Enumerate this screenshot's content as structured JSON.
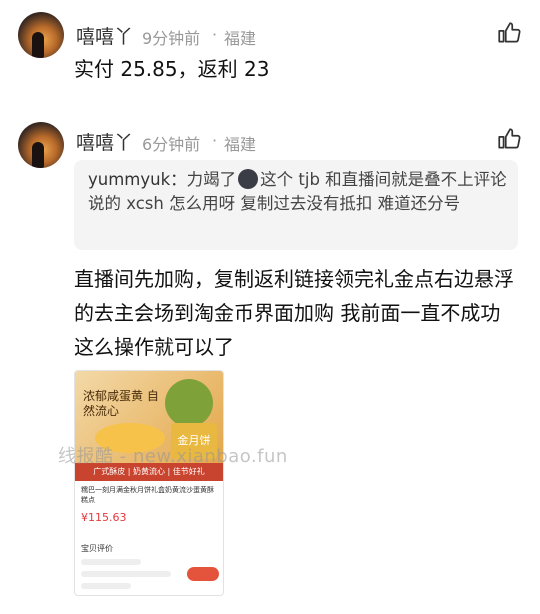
{
  "comments": [
    {
      "name": "嘻嘻丫",
      "time": "9分钟前",
      "separator": "·",
      "location": "福建",
      "text": "实付 25.85，返利 23"
    },
    {
      "name": "嘻嘻丫",
      "time": "6分钟前",
      "separator": "·",
      "location": "福建",
      "quote_user": "yummyuk：",
      "quote_text_a": "力竭了",
      "quote_text_b": "这个 tjb 和直播间就是叠不上评论说的 xcsh 怎么用呀 复制过去没有抵扣 难道还分号",
      "text": "直播间先加购，复制返利链接领完礼金点右边悬浮的去主会场到淘金币界面加购 我前面一直不成功 这么操作就可以了"
    }
  ],
  "thumbnail": {
    "top_text": "浓郁咸蛋黄 自然流心",
    "badge": "金月饼",
    "bar": "广式酥皮 | 奶黄流心 | 佳节好礼",
    "title": "糯巴一刻月满金秋月饼礼盒奶黄流沙蛋黄酥糕点",
    "price": "¥115.63",
    "section": "宝贝评价"
  },
  "watermark": "线报酷 - new.xianbao.fun",
  "icons": {
    "like": "thumbs-up-icon",
    "emoji": "dark-face-emoji-icon"
  }
}
